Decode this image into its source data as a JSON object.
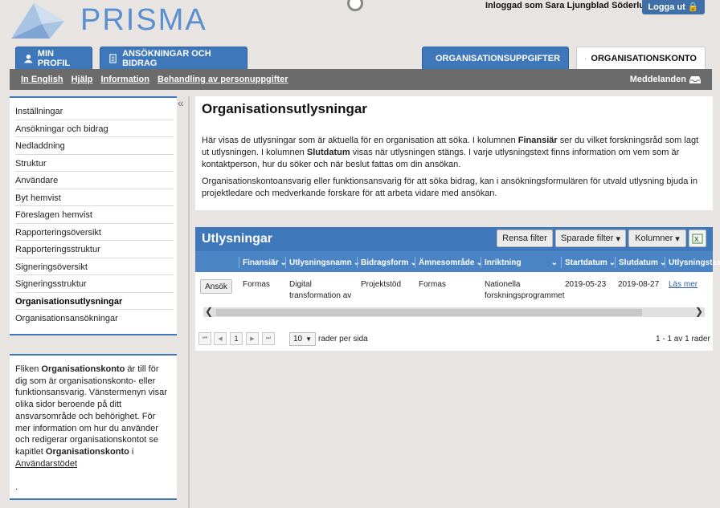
{
  "header": {
    "brand": "PRISMA",
    "user_label": "Inloggad som Sara Ljungblad Söderlund",
    "logout_label": "Logga ut"
  },
  "tabs": [
    {
      "label": "MIN PROFIL",
      "icon": "user-icon"
    },
    {
      "label": "ANSÖKNINGAR OCH BIDRAG",
      "icon": "document-icon"
    },
    {
      "label": "ORGANISATIONSUPPGIFTER",
      "icon": "checkbox-icon"
    },
    {
      "label": "ORGANISATIONSKONTO",
      "icon": "org-chart-icon"
    }
  ],
  "subnav": {
    "links": [
      "In English",
      "Hjälp",
      "Information",
      "Behandling av personuppgifter"
    ],
    "messages": "Meddelanden"
  },
  "sidebar": {
    "items": [
      "Inställningar",
      "Ansökningar och bidrag",
      "Nedladdning",
      "Struktur",
      "Användare",
      "Byt hemvist",
      "Föreslagen hemvist",
      "Rapporteringsöversikt",
      "Rapporteringsstruktur",
      "Signeringsöversikt",
      "Signeringsstruktur",
      "Organisationsutlysningar",
      "Organisationsansökningar"
    ],
    "active_index": 11
  },
  "infobox": {
    "p1": "Fliken ",
    "b1": "Organisationskonto",
    "p2": " är till för dig som är organisationskonto- eller funktionsansvarig. Vänstermenyn visar olika sidor beroende på ditt ansvarsområde och behörighet. För mer information om hur du använder och redigerar organisationskontot se kapitlet ",
    "b2": "Organisationskonto",
    "p3": " i ",
    "link": "Användarstödet",
    "tail": "."
  },
  "main": {
    "title": "Organisationsutlysningar",
    "para1_a": "Här visas de utlysningar som är aktuella för en organisation att söka. I kolumnen ",
    "para1_b": "Finansiär",
    "para1_c": " ser du vilket forskningsråd som lagt ut utlysningen. I kolumnen ",
    "para1_d": "Slutdatum",
    "para1_e": " visas när utlysningen stängs. I varje utlysningstext finns information om vem som är kontaktperson, hur du söker och när beslut fattas om din ansökan.",
    "para2": "Organisationskontoansvarig eller funktionsansvarig för att söka bidrag, kan i ansökningsformulären för utvald utlysning bjuda in projektledare och medverkande forskare för att arbeta vidare med ansökan."
  },
  "grid": {
    "title": "Utlysningar",
    "clear_filter": "Rensa filter",
    "saved_filters": "Sparade filter",
    "columns_btn": "Kolumner",
    "columns": [
      "Finansiär",
      "Utlysningsnamn",
      "Bidragsform",
      "Ämnesområde",
      "Inriktning",
      "Startdatum",
      "Slutdatum",
      "Utlysningstext"
    ],
    "row": {
      "apply": "Ansök",
      "financier": "Formas",
      "name_l1": "Digital",
      "name_l2": "transformation av",
      "form": "Projektstöd",
      "subject": "Formas",
      "direction_l1": "Nationella",
      "direction_l2": "forskningsprogrammet",
      "start": "2019-05-23",
      "end": "2019-08-27",
      "link": "Läs mer"
    },
    "pager": {
      "page": "1",
      "page_size": "10",
      "per_page_label": "rader per sida",
      "summary": "1 - 1 av 1 rader"
    }
  },
  "colors": {
    "accent": "#3e77ba",
    "subnav": "#6b6b6b",
    "background": "#e7e4e1"
  }
}
